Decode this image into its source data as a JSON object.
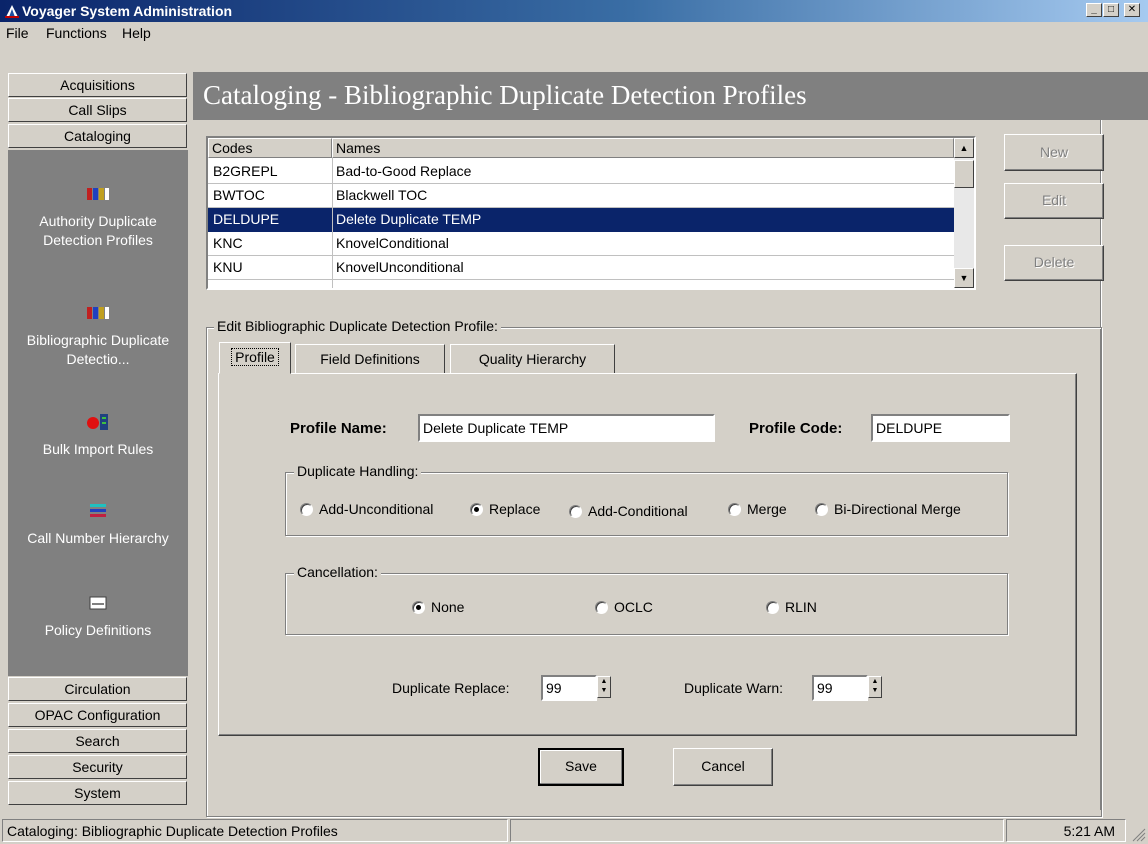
{
  "window": {
    "title": "Voyager System Administration",
    "controls": [
      "minimize",
      "maximize",
      "close"
    ]
  },
  "menubar": {
    "items": [
      "File",
      "Functions",
      "Help"
    ]
  },
  "sidebar": {
    "top_modules": [
      "Acquisitions",
      "Call Slips",
      "Cataloging"
    ],
    "items": [
      {
        "label": "Authority Duplicate Detection Profiles",
        "icon": "profile-icon"
      },
      {
        "label": "Bibliographic Duplicate Detectio...",
        "icon": "profile-icon"
      },
      {
        "label": "Bulk Import Rules",
        "icon": "import-icon"
      },
      {
        "label": "Call Number Hierarchy",
        "icon": "hierarchy-icon"
      },
      {
        "label": "Policy Definitions",
        "icon": "policy-icon"
      }
    ],
    "bottom_modules": [
      "Circulation",
      "OPAC Configuration",
      "Search",
      "Security",
      "System"
    ]
  },
  "header": {
    "title": "Cataloging - Bibliographic Duplicate Detection Profiles"
  },
  "profiles_table": {
    "columns": [
      "Codes",
      "Names"
    ],
    "rows": [
      {
        "code": "B2GREPL",
        "name": "Bad-to-Good Replace"
      },
      {
        "code": "BWTOC",
        "name": "Blackwell TOC"
      },
      {
        "code": "DELDUPE",
        "name": "Delete Duplicate TEMP",
        "selected": true
      },
      {
        "code": "KNC",
        "name": "KnovelConditional"
      },
      {
        "code": "KNU",
        "name": "KnovelUnconditional"
      }
    ]
  },
  "actions": {
    "new_label": "New",
    "edit_label": "Edit",
    "delete_label": "Delete"
  },
  "edit_group": {
    "legend": "Edit  Bibliographic Duplicate Detection Profile:",
    "tabs": [
      "Profile",
      "Field Definitions",
      "Quality Hierarchy"
    ],
    "active_tab": "Profile"
  },
  "profile_form": {
    "name_label": "Profile Name:",
    "name_value": "Delete Duplicate TEMP",
    "code_label": "Profile Code:",
    "code_value": "DELDUPE",
    "duplicate_handling": {
      "legend": "Duplicate Handling:",
      "options": [
        "Add-Unconditional",
        "Replace",
        "Add-Conditional",
        "Merge",
        "Bi-Directional Merge"
      ],
      "selected": "Replace"
    },
    "cancellation": {
      "legend": "Cancellation:",
      "options": [
        "None",
        "OCLC",
        "RLIN"
      ],
      "selected": "None"
    },
    "duplicate_replace_label": "Duplicate Replace:",
    "duplicate_replace_value": "99",
    "duplicate_warn_label": "Duplicate Warn:",
    "duplicate_warn_value": "99"
  },
  "footer_buttons": {
    "save_label": "Save",
    "cancel_label": "Cancel"
  },
  "statusbar": {
    "message": "Cataloging:  Bibliographic Duplicate Detection Profiles",
    "time": "5:21 AM"
  },
  "colors": {
    "title_bar": "#0a246a",
    "selection": "#0a246a",
    "panel": "#d4d0c8",
    "sidebar": "#808080"
  }
}
